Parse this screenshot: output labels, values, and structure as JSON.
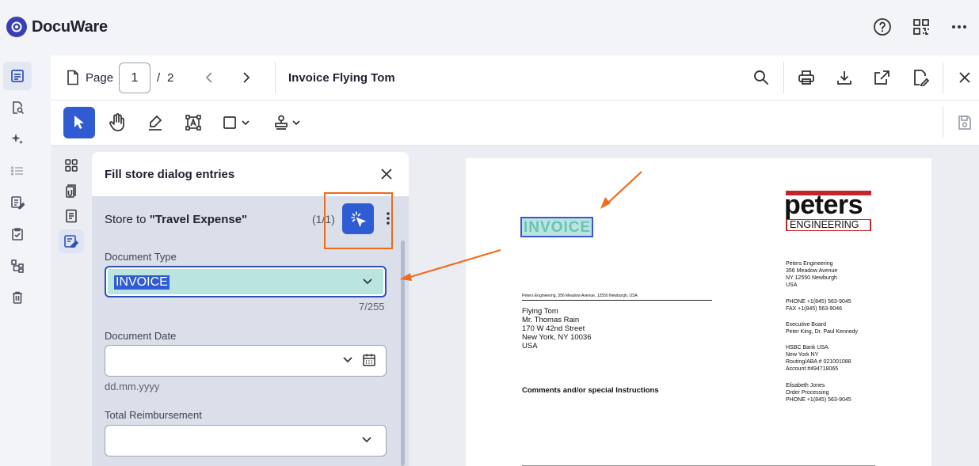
{
  "app": {
    "name": "DocuWare"
  },
  "topbar": {
    "help_icon": "help-circle-icon",
    "qr_icon": "qr-code-icon",
    "more_icon": "more-horizontal-icon"
  },
  "viewer_header": {
    "page_label": "Page",
    "page_value": "1",
    "page_separator": "/",
    "page_total": "2",
    "document_title": "Invoice Flying Tom"
  },
  "panel": {
    "title": "Fill store dialog entries",
    "store_prefix": "Store to",
    "store_name": "\"Travel Expense\"",
    "counter": "(1/1)",
    "fields": {
      "document_type": {
        "label": "Document Type",
        "value": "INVOICE",
        "count": "7/255"
      },
      "document_date": {
        "label": "Document Date",
        "value": "",
        "hint": "dd.mm.yyyy"
      },
      "total_reimbursement": {
        "label": "Total Reimbursement",
        "value": ""
      }
    }
  },
  "document": {
    "heading": "INVOICE",
    "logo_line1": "peters",
    "logo_line2": "ENGINEERING",
    "sender_line": "Peters Engineering, 356 Meadow Avenue, 12550 Newburgh, USA",
    "recipient": [
      "Flying Tom",
      "Mr. Thomas Rain",
      "170 W 42nd Street",
      "New York, NY 10036",
      "USA"
    ],
    "comments": "Comments and/or special Instructions",
    "company_block": [
      "Peters Engineering",
      "356 Meadow Avenue",
      "NY 12550 Newburgh",
      "USA"
    ],
    "contact_block": [
      "PHONE   +1(845) 563-9045",
      "FAX       +1(845) 563-9046"
    ],
    "board_block": [
      "Executive Board",
      "Peter King, Dr. Paul Kennedy"
    ],
    "bank_block": [
      "HSBC Bank USA",
      "New York NY",
      "Routing/ABA # 021001088",
      "Account #494718065"
    ],
    "processing_block": [
      "Elisabeth Jones",
      "Order Processing",
      "PHONE  +1(845) 563-9045"
    ]
  },
  "colors": {
    "accent": "#2f5bd3",
    "annotation": "#f26a1b",
    "field_highlight": "#b9e4e0",
    "logo_red": "#c4252b"
  }
}
